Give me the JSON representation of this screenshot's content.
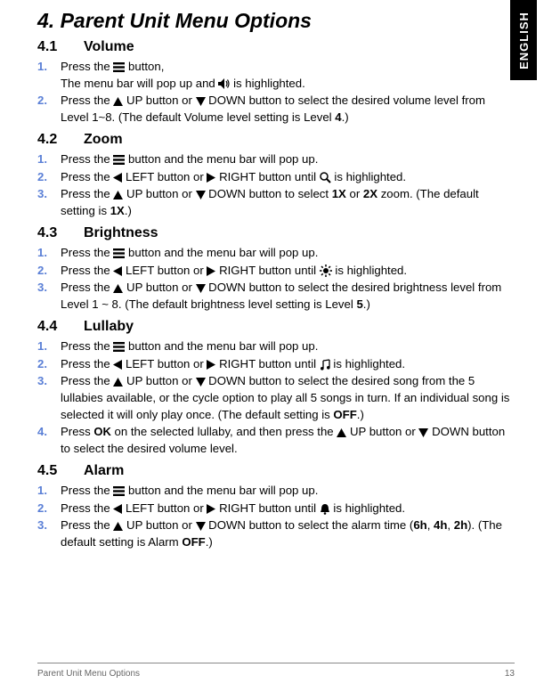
{
  "lang_tab": "ENGLISH",
  "title": "4. Parent Unit Menu Options",
  "sections": [
    {
      "num": "4.1",
      "name": "Volume",
      "steps": [
        {
          "n": "1.",
          "parts": [
            "Press the ",
            {
              "icon": "menu"
            },
            " button,\nThe menu bar will pop up and ",
            {
              "icon": "speaker"
            },
            " is highlighted."
          ]
        },
        {
          "n": "2.",
          "parts": [
            "Press the ",
            {
              "icon": "up"
            },
            " UP button or ",
            {
              "icon": "down"
            },
            " DOWN button to select the desired volume level from Level 1~8. (The default Volume level setting is Level ",
            {
              "b": "4"
            },
            ".)"
          ]
        }
      ]
    },
    {
      "num": "4.2",
      "name": "Zoom",
      "steps": [
        {
          "n": "1.",
          "parts": [
            "Press the ",
            {
              "icon": "menu"
            },
            " button and the menu bar will pop up."
          ]
        },
        {
          "n": "2.",
          "parts": [
            "Press the ",
            {
              "icon": "left"
            },
            " LEFT button or ",
            {
              "icon": "right"
            },
            " RIGHT button until  ",
            {
              "icon": "zoom"
            },
            "  is highlighted."
          ]
        },
        {
          "n": "3.",
          "parts": [
            "Press the ",
            {
              "icon": "up"
            },
            " UP button or ",
            {
              "icon": "down"
            },
            " DOWN button to select ",
            {
              "b": "1X"
            },
            " or ",
            {
              "b": "2X"
            },
            " zoom. (The default setting is ",
            {
              "b": "1X"
            },
            ".)"
          ]
        }
      ]
    },
    {
      "num": "4.3",
      "name": "Brightness",
      "steps": [
        {
          "n": "1.",
          "parts": [
            "Press the ",
            {
              "icon": "menu"
            },
            " button and the menu bar will pop up."
          ]
        },
        {
          "n": "2.",
          "parts": [
            "Press the ",
            {
              "icon": "left"
            },
            " LEFT button or ",
            {
              "icon": "right"
            },
            " RIGHT button until ",
            {
              "icon": "brightness"
            },
            " is highlighted."
          ]
        },
        {
          "n": "3.",
          "parts": [
            "Press the ",
            {
              "icon": "up"
            },
            " UP button or ",
            {
              "icon": "down"
            },
            " DOWN button to select the desired brightness level from Level 1 ~ 8. (The default brightness level setting is Level ",
            {
              "b": "5"
            },
            ".)"
          ]
        }
      ]
    },
    {
      "num": "4.4",
      "name": "Lullaby",
      "steps": [
        {
          "n": "1.",
          "parts": [
            "Press the ",
            {
              "icon": "menu"
            },
            " button and the menu bar will pop up."
          ]
        },
        {
          "n": "2.",
          "parts": [
            "Press the ",
            {
              "icon": "left"
            },
            " LEFT button or ",
            {
              "icon": "right"
            },
            " RIGHT button until ",
            {
              "icon": "music"
            },
            " is highlighted."
          ]
        },
        {
          "n": "3.",
          "parts": [
            "Press the ",
            {
              "icon": "up"
            },
            " UP button or ",
            {
              "icon": "down"
            },
            " DOWN button to select the desired song from the 5 lullabies available, or the cycle option to play all 5 songs in turn. If an individual song is selected it will only play once. (The default setting is ",
            {
              "b": "OFF"
            },
            ".)"
          ]
        },
        {
          "n": "4.",
          "parts": [
            "Press ",
            {
              "icon": "ok"
            },
            " on the selected lullaby, and then press the ",
            {
              "icon": "up"
            },
            " UP button or ",
            {
              "icon": "down"
            },
            " DOWN button to select the desired volume level."
          ]
        }
      ]
    },
    {
      "num": "4.5",
      "name": "Alarm",
      "steps": [
        {
          "n": "1.",
          "parts": [
            "Press the ",
            {
              "icon": "menu"
            },
            " button and the menu bar will pop up."
          ]
        },
        {
          "n": "2.",
          "parts": [
            "Press the ",
            {
              "icon": "left"
            },
            " LEFT button or ",
            {
              "icon": "right"
            },
            " RIGHT button until  ",
            {
              "icon": "bell"
            },
            "  is highlighted."
          ]
        },
        {
          "n": "3.",
          "parts": [
            "Press the ",
            {
              "icon": "up"
            },
            " UP button or ",
            {
              "icon": "down"
            },
            " DOWN button to select the alarm time (",
            {
              "b": "6h"
            },
            ", ",
            {
              "b": "4h"
            },
            ", ",
            {
              "b": "2h"
            },
            "). (The default setting is Alarm ",
            {
              "b": "OFF"
            },
            ".)"
          ]
        }
      ]
    }
  ],
  "footer_left": "Parent Unit Menu Options",
  "footer_right": "13"
}
